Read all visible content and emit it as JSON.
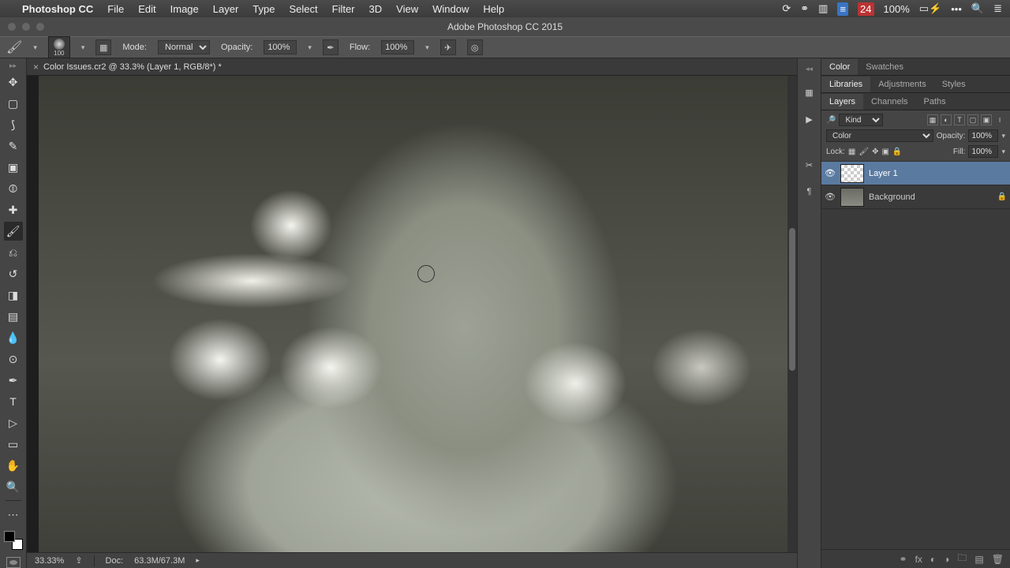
{
  "mac_menu": {
    "app": "Photoshop CC",
    "items": [
      "File",
      "Edit",
      "Image",
      "Layer",
      "Type",
      "Select",
      "Filter",
      "3D",
      "View",
      "Window",
      "Help"
    ],
    "battery": "100%",
    "date_badge": "24"
  },
  "window": {
    "title": "Adobe Photoshop CC 2015"
  },
  "options": {
    "brush_size": "100",
    "mode_label": "Mode:",
    "mode": "Normal",
    "opacity_label": "Opacity:",
    "opacity": "100%",
    "flow_label": "Flow:",
    "flow": "100%"
  },
  "doc_tab": {
    "title": "Color Issues.cr2 @ 33.3% (Layer 1, RGB/8*) *"
  },
  "status": {
    "zoom": "33.33%",
    "doc_label": "Doc:",
    "doc_size": "63.3M/67.3M"
  },
  "panels": {
    "tabs1": [
      "Color",
      "Swatches"
    ],
    "tabs2": [
      "Libraries",
      "Adjustments",
      "Styles"
    ],
    "tabs3": [
      "Layers",
      "Channels",
      "Paths"
    ]
  },
  "layers": {
    "filter_label": "Kind",
    "blend": "Color",
    "opacity_label": "Opacity:",
    "opacity": "100%",
    "lock_label": "Lock:",
    "fill_label": "Fill:",
    "fill": "100%",
    "items": [
      {
        "name": "Layer 1",
        "selected": true,
        "locked": false
      },
      {
        "name": "Background",
        "selected": false,
        "locked": true
      }
    ]
  }
}
